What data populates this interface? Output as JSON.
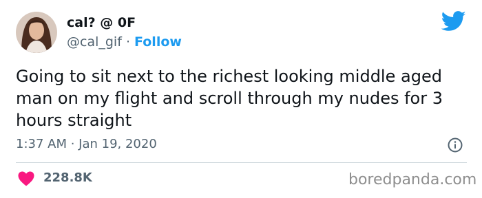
{
  "user": {
    "display_name": "cal? @ 0F",
    "handle": "@cal_gif",
    "separator": "·",
    "follow_label": "Follow"
  },
  "tweet": {
    "text": "Going to sit next to the richest looking middle aged man on my flight and scroll through my nudes for 3 hours straight",
    "timestamp": "1:37 AM · Jan 19, 2020"
  },
  "stats": {
    "likes": "228.8K"
  },
  "watermark": "boredpanda.com",
  "icons": {
    "brand": "twitter-bird-icon",
    "info": "info-icon",
    "like": "heart-icon"
  },
  "colors": {
    "accent": "#1d9bf0",
    "like": "#f91880",
    "text": "#0f1419",
    "secondary": "#536471",
    "divider": "#cfd9de"
  }
}
